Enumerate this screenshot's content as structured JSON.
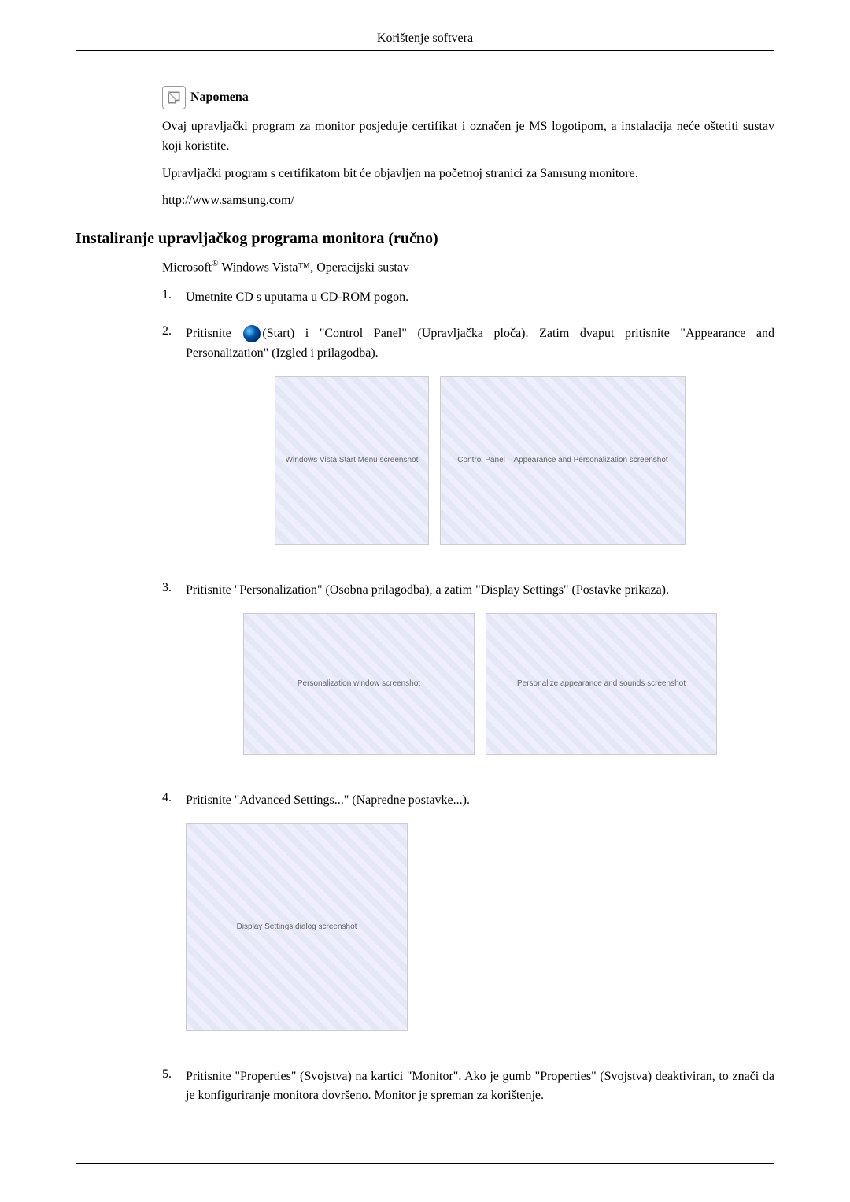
{
  "header_title": "Korištenje softvera",
  "note": {
    "icon_name": "note-icon",
    "label": "Napomena",
    "paragraph1": "Ovaj upravljački program za monitor posjeduje certifikat i označen je MS logotipom, a instalacija neće oštetiti sustav koji koristite.",
    "paragraph2": "Upravljački program s certifikatom bit će objavljen na početnoj stranici za Samsung monitore.",
    "url": "http://www.samsung.com/"
  },
  "section_heading": "Instaliranje upravljačkog programa monitora (ručno)",
  "subheading_prefix": "Microsoft",
  "subheading_rest": " Windows Vista™, Operacijski sustav",
  "steps": {
    "s1": {
      "num": "1.",
      "text": "Umetnite CD s uputama u CD-ROM pogon."
    },
    "s2": {
      "num": "2.",
      "text_before_icon": "Pritisnite ",
      "text_after_icon": "(Start) i \"Control Panel\" (Upravljačka ploča). Zatim dvaput pritisnite \"Appearance and Personalization\" (Izgled i prilagodba)."
    },
    "s3": {
      "num": "3.",
      "text": "Pritisnite \"Personalization\" (Osobna prilagodba), a zatim \"Display Settings\" (Postavke prikaza)."
    },
    "s4": {
      "num": "4.",
      "text": "Pritisnite \"Advanced Settings...\" (Napredne postavke...)."
    },
    "s5": {
      "num": "5.",
      "text": "Pritisnite \"Properties\" (Svojstva) na kartici \"Monitor\". Ako je gumb \"Properties\" (Svojstva) deaktiviran, to znači da je konfiguriranje monitora dovršeno. Monitor je spreman za korištenje."
    }
  },
  "images": {
    "row1a": "Windows Vista Start Menu screenshot",
    "row1b": "Control Panel – Appearance and Personalization screenshot",
    "row2a": "Personalization window screenshot",
    "row2b": "Personalize appearance and sounds screenshot",
    "row3": "Display Settings dialog screenshot"
  }
}
